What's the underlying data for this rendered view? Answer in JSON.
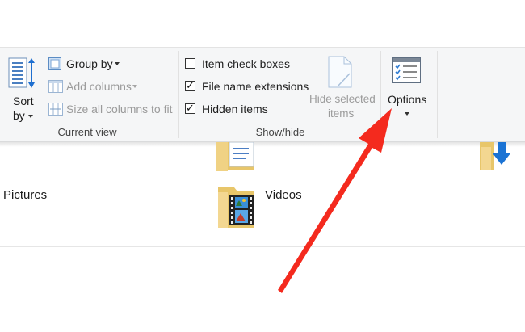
{
  "ribbon": {
    "current_view": {
      "sort_by_line1": "Sort",
      "sort_by_line2": "by",
      "group_by": "Group by",
      "add_columns": "Add columns",
      "size_all_columns": "Size all columns to fit",
      "label": "Current view"
    },
    "show_hide": {
      "item_check_boxes": {
        "label": "Item check boxes",
        "checked": false
      },
      "file_name_extensions": {
        "label": "File name extensions",
        "checked": true
      },
      "hidden_items": {
        "label": "Hidden items",
        "checked": true
      },
      "hide_selected_line1": "Hide selected",
      "hide_selected_line2": "items",
      "label": "Show/hide"
    },
    "options": {
      "label": "Options"
    }
  },
  "content": {
    "items": [
      {
        "name": "Pictures"
      },
      {
        "name": "Videos"
      }
    ]
  },
  "colors": {
    "arrow": "#f42a1e",
    "folder": "#e8c66a",
    "download_arrow": "#1b73d4"
  },
  "icons": [
    "sort-by-icon",
    "group-by-icon",
    "add-columns-icon",
    "size-columns-icon",
    "hide-selected-icon",
    "options-icon",
    "folder-icon",
    "download-icon",
    "video-film-icon"
  ]
}
